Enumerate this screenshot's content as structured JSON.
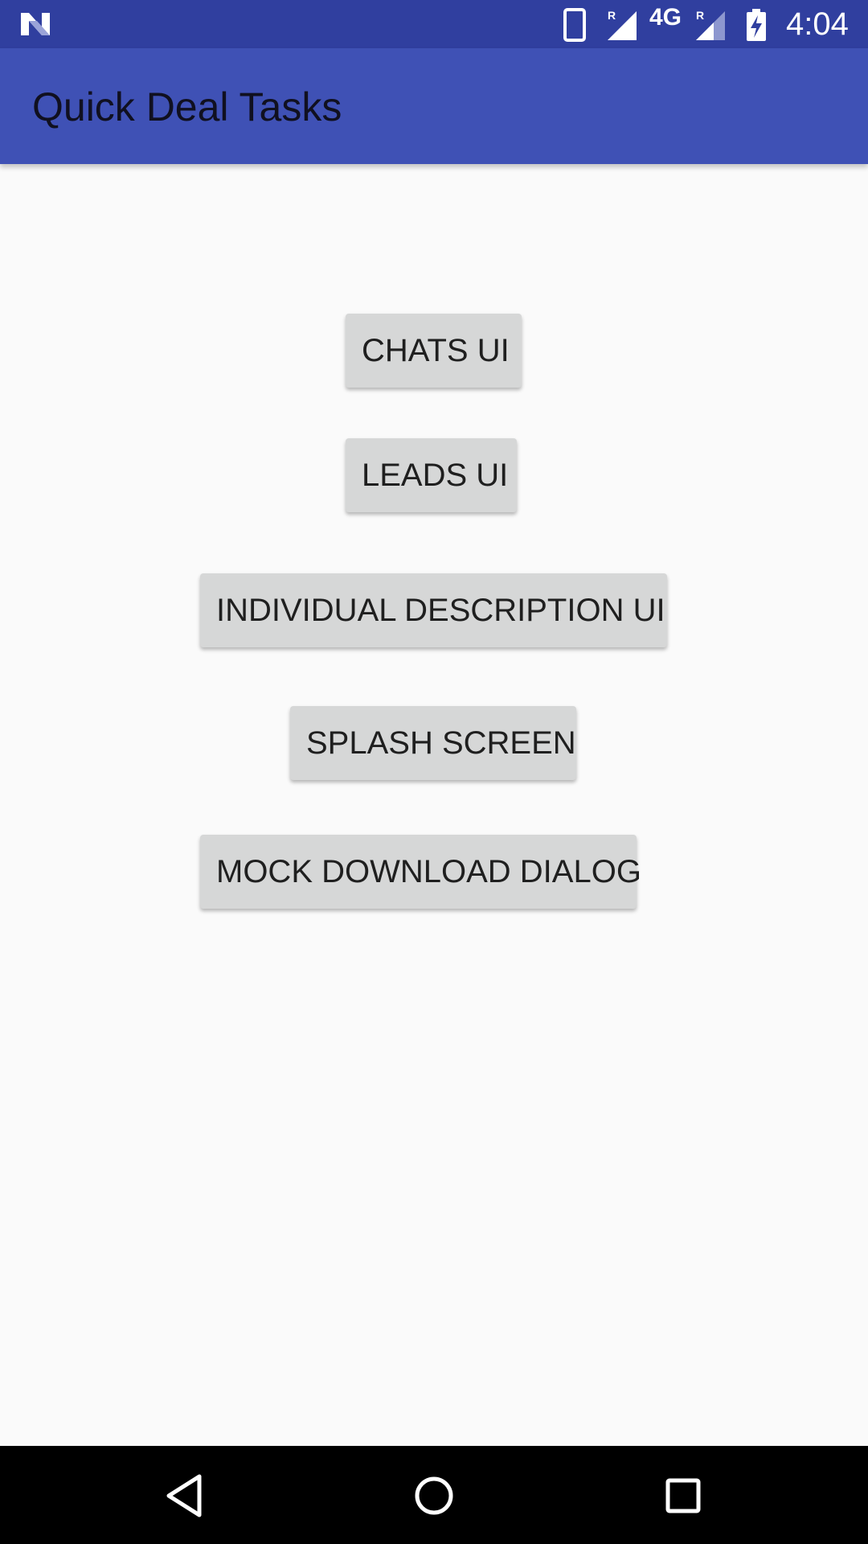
{
  "status_bar": {
    "network_type": "4G",
    "roaming_indicator_1": "R",
    "roaming_indicator_2": "R",
    "time": "4:04",
    "icons": [
      "n-logo-icon",
      "phone-icon",
      "signal-icon",
      "signal-icon",
      "battery-charging-icon"
    ]
  },
  "app_bar": {
    "title": "Quick Deal Tasks",
    "color": "#3f51b5"
  },
  "main": {
    "buttons": [
      {
        "label": "CHATS UI"
      },
      {
        "label": "LEADS UI"
      },
      {
        "label": "INDIVIDUAL DESCRIPTION UI"
      },
      {
        "label": "SPLASH SCREEN"
      },
      {
        "label": "MOCK DOWNLOAD DIALOG"
      }
    ]
  },
  "nav_bar": {
    "icons": [
      "back-icon",
      "home-icon",
      "recents-icon"
    ]
  },
  "colors": {
    "status_bar": "#303f9f",
    "app_bar": "#3f51b5",
    "background": "#fafafa",
    "button": "#d6d7d7"
  }
}
